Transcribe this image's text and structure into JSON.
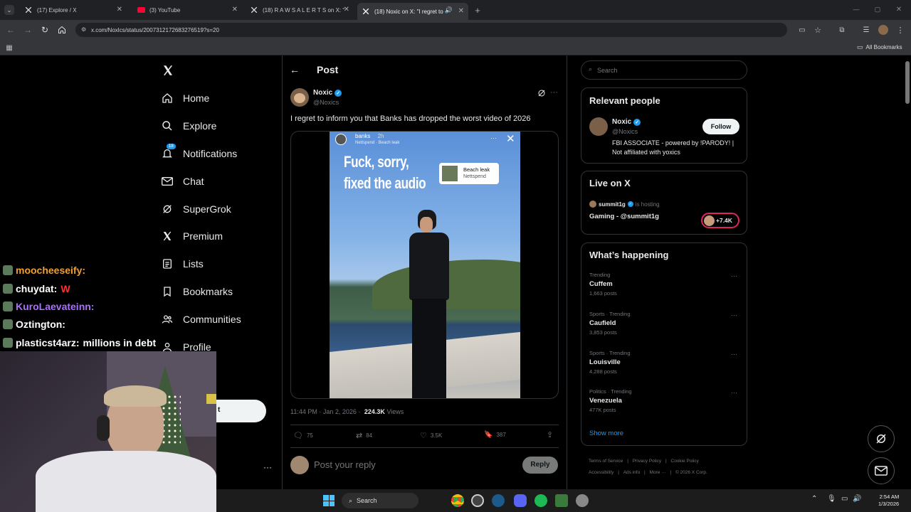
{
  "browser": {
    "tabs": [
      {
        "title": "(17) Explore / X",
        "icon": "x-logo-icon"
      },
      {
        "title": "(3) YouTube",
        "icon": "youtube-icon"
      },
      {
        "title": "(18) R A W S A L E R T S on X: \"",
        "icon": "x-logo-icon"
      },
      {
        "title": "(18) Noxic on X: \"I regret to",
        "icon": "x-logo-icon"
      }
    ],
    "url": "x.com/Noxlcs/status/2007312172683276519?s=20",
    "bookmarks_label": "All Bookmarks"
  },
  "sidebar": {
    "items": [
      {
        "label": "Home",
        "icon": "home-icon"
      },
      {
        "label": "Explore",
        "icon": "search-icon"
      },
      {
        "label": "Notifications",
        "icon": "bell-icon",
        "badge": "18"
      },
      {
        "label": "Chat",
        "icon": "mail-icon"
      },
      {
        "label": "SuperGrok",
        "icon": "grok-icon"
      },
      {
        "label": "Premium",
        "icon": "x-logo-icon"
      },
      {
        "label": "Lists",
        "icon": "list-icon"
      },
      {
        "label": "Bookmarks",
        "icon": "bookmark-icon"
      },
      {
        "label": "Communities",
        "icon": "people-icon"
      },
      {
        "label": "Profile",
        "icon": "person-icon"
      }
    ],
    "post_button_fragment": "t"
  },
  "post": {
    "header": "Post",
    "author": {
      "name": "Noxic",
      "handle": "@Noxics"
    },
    "text": "I regret to inform you that Banks has dropped the worst video of 2026",
    "media": {
      "story_user": "banks",
      "story_time": "2h",
      "story_music": "Nettspend · Beach leak",
      "overlay_text_1": "Fuck, sorry,",
      "overlay_text_2": "fixed the audio",
      "sticker_title": "Beach leak",
      "sticker_artist": "Nettspend"
    },
    "timestamp": "11:44 PM · Jan 2, 2026 ·",
    "views_count": "224.3K",
    "views_label": "Views",
    "stats": {
      "replies": "75",
      "reposts": "84",
      "likes": "3.5K",
      "bookmarks": "387"
    },
    "reply_placeholder": "Post your reply",
    "reply_button": "Reply"
  },
  "right": {
    "search_placeholder": "Search",
    "relevant_title": "Relevant people",
    "person": {
      "name": "Noxic",
      "handle": "@Noxics",
      "bio": "FBI ASSOCIATE - powered by !PARODY! | Not affiliated with yoxics",
      "follow": "Follow"
    },
    "live_title": "Live on X",
    "live": {
      "host": "summit1g",
      "hosting": "is hosting",
      "title": "Gaming - @summit1g",
      "viewers": "+7.4K"
    },
    "happening_title": "What’s happening",
    "trends": [
      {
        "category": "Trending",
        "name": "Cuffem",
        "posts": "1,663 posts"
      },
      {
        "category": "Sports · Trending",
        "name": "Caufield",
        "posts": "3,853 posts"
      },
      {
        "category": "Sports · Trending",
        "name": "Louisville",
        "posts": "4,288 posts"
      },
      {
        "category": "Politics · Trending",
        "name": "Venezuela",
        "posts": "477K posts"
      }
    ],
    "show_more": "Show more",
    "footer_row1": [
      "Terms of Service",
      "Privacy Policy",
      "Cookie Policy"
    ],
    "footer_row2": [
      "Accessibility",
      "Ads info",
      "More ···",
      "© 2026 X Corp."
    ]
  },
  "chat": [
    {
      "user": "moocheeseify:",
      "msg": "",
      "color": "#f0a030"
    },
    {
      "user": "chuydat:",
      "msg": "W",
      "color": "#ffffff"
    },
    {
      "user": "KuroLaevateinn:",
      "msg": "",
      "color": "#a970ff"
    },
    {
      "user": "Oztington:",
      "msg": "",
      "color": "#ffffff"
    },
    {
      "user": "plasticst4arz:",
      "msg": "millions in debt",
      "color": "#ffffff"
    }
  ],
  "taskbar": {
    "search": "Search",
    "time": "2:54 AM",
    "date": "1/3/2026"
  },
  "colors": {
    "accent": "#1d9bf0",
    "bg": "#000000",
    "border": "#2f3336",
    "muted": "#71767b"
  }
}
